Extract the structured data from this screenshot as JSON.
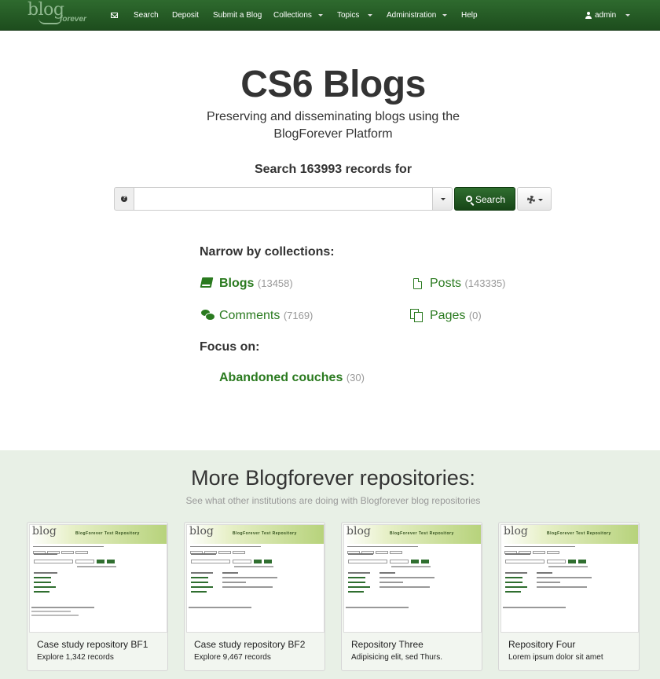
{
  "navbar": {
    "brand_main": "blog",
    "brand_sub": "forever",
    "items": [
      "Search",
      "Deposit",
      "Submit a Blog",
      "Collections",
      "Topics",
      "Administration",
      "Help"
    ],
    "user": "admin"
  },
  "hero": {
    "title": "CS6 Blogs",
    "subtitle": "Preserving and disseminating blogs using the BlogForever Platform",
    "search_heading": "Search 163993 records for"
  },
  "search": {
    "value": "",
    "placeholder": "",
    "button_label": "Search",
    "help_icon": "question-icon",
    "options_icon": "gear-icon"
  },
  "collections": {
    "heading": "Narrow by collections:",
    "items": [
      {
        "name": "Blogs",
        "count": "(13458)",
        "icon": "book-icon"
      },
      {
        "name": "Posts",
        "count": "(143335)",
        "icon": "file-icon"
      },
      {
        "name": "Comments",
        "count": "(7169)",
        "icon": "comments-icon"
      },
      {
        "name": "Pages",
        "count": "(0)",
        "icon": "pages-icon"
      }
    ],
    "focus_heading": "Focus on:",
    "focus_items": [
      {
        "name": "Abandoned couches",
        "count": "(30)"
      }
    ]
  },
  "repositories": {
    "title": "More Blogforever repositories:",
    "subtitle": "See what other institutions are doing with Blogforever blog repositories",
    "cards": [
      {
        "thumb_logo": "blog",
        "thumb_title": "BlogForever Test Repository",
        "title": "Case study repository BF1",
        "description": "Explore 1,342 records"
      },
      {
        "thumb_logo": "blog",
        "thumb_title": "BlogForever Test Repository",
        "title": "Case study repository BF2",
        "description": "Explore 9,467 records"
      },
      {
        "thumb_logo": "blog",
        "thumb_title": "BlogForever Test Repository",
        "title": "Repository Three",
        "description": "Adipisicing elit, sed Thurs."
      },
      {
        "thumb_logo": "blog",
        "thumb_title": "BlogForever Test Repository",
        "title": "Repository Four",
        "description": "Lorem ipsum dolor sit amet"
      }
    ]
  },
  "colors": {
    "navbar": "#1d4d1d",
    "accent_green": "#2a7a1f",
    "count_gray": "#999999",
    "footer_bg": "#e8f0e6"
  }
}
